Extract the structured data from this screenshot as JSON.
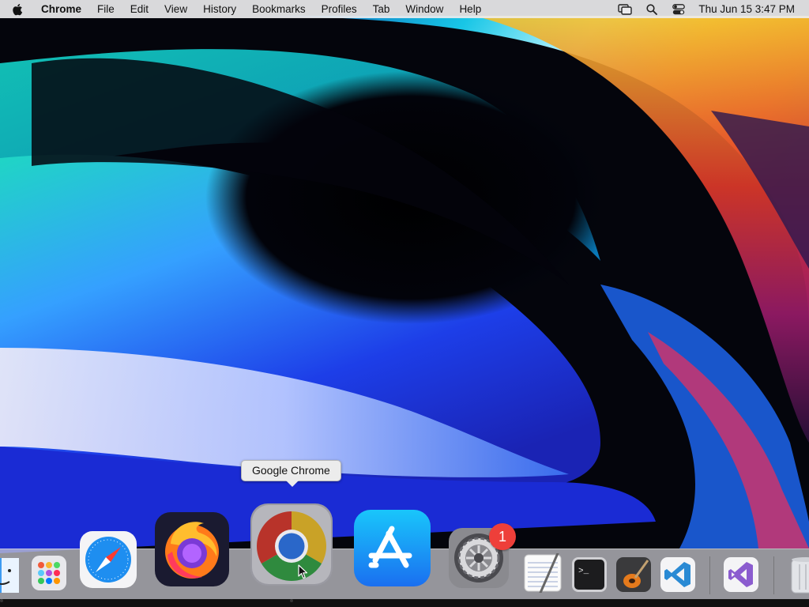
{
  "menubar": {
    "app_name": "Chrome",
    "items": [
      "File",
      "Edit",
      "View",
      "History",
      "Bookmarks",
      "Profiles",
      "Tab",
      "Window",
      "Help"
    ],
    "status_icons": [
      "screen-mirror-icon",
      "spotlight-search-icon",
      "control-center-icon"
    ],
    "clock": "Thu Jun 15  3:47 PM"
  },
  "tooltip": {
    "text": "Google Chrome"
  },
  "dock": {
    "apps": [
      "finder-icon",
      "launchpad-icon",
      "safari-icon",
      "firefox-icon",
      "google-chrome-icon",
      "app-store-icon",
      "system-preferences-icon",
      "textedit-icon",
      "terminal-icon",
      "garageband-icon",
      "vscode-icon",
      "visual-studio-icon",
      "trash-icon"
    ],
    "system_preferences_badge": "1"
  },
  "colors": {
    "menubar": "#ececee",
    "badge": "#ee3f3a",
    "safari_blue": "#1e8ef0",
    "app_store_blue": "#1a82fb",
    "vscode_blue": "#2a8ad4",
    "visual_studio_purple": "#8b5ccf"
  }
}
